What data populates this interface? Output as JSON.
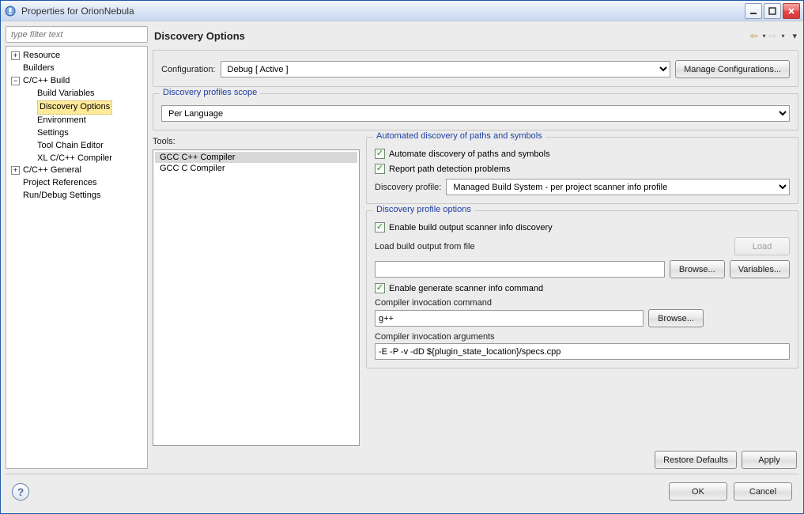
{
  "window": {
    "title": "Properties for OrionNebula"
  },
  "sidebar": {
    "filter_placeholder": "type filter text",
    "items": {
      "resource": "Resource",
      "builders": "Builders",
      "c_build": "C/C++ Build",
      "build_variables": "Build Variables",
      "discovery_options": "Discovery Options",
      "environment": "Environment",
      "settings": "Settings",
      "tool_chain_editor": "Tool Chain Editor",
      "xl_compiler": "XL C/C++ Compiler",
      "c_general": "C/C++ General",
      "project_refs": "Project References",
      "run_debug": "Run/Debug Settings"
    }
  },
  "page": {
    "title": "Discovery Options",
    "config_label": "Configuration:",
    "config_value": "Debug  [ Active ]",
    "manage_configs": "Manage Configurations...",
    "scope_title": "Discovery profiles scope",
    "scope_value": "Per Language",
    "tools_label": "Tools:",
    "tools_list": [
      "GCC C++ Compiler",
      "GCC C Compiler"
    ],
    "auto_group_title": "Automated discovery of paths and symbols",
    "cb_automate": "Automate discovery of paths and symbols",
    "cb_report": "Report path detection problems",
    "discovery_profile_label": "Discovery profile:",
    "discovery_profile_value": "Managed Build System - per project scanner info profile",
    "opts_group_title": "Discovery profile options",
    "cb_enable_output": "Enable build output scanner info discovery",
    "load_from_file_label": "Load build output from file",
    "load_btn": "Load",
    "browse_btn": "Browse...",
    "variables_btn": "Variables...",
    "cb_enable_generate": "Enable generate scanner info command",
    "invocation_cmd_label": "Compiler invocation command",
    "invocation_cmd_value": "g++",
    "invocation_args_label": "Compiler invocation arguments",
    "invocation_args_value": "-E -P -v -dD ${plugin_state_location}/specs.cpp",
    "restore_defaults": "Restore Defaults",
    "apply": "Apply",
    "ok": "OK",
    "cancel": "Cancel"
  }
}
